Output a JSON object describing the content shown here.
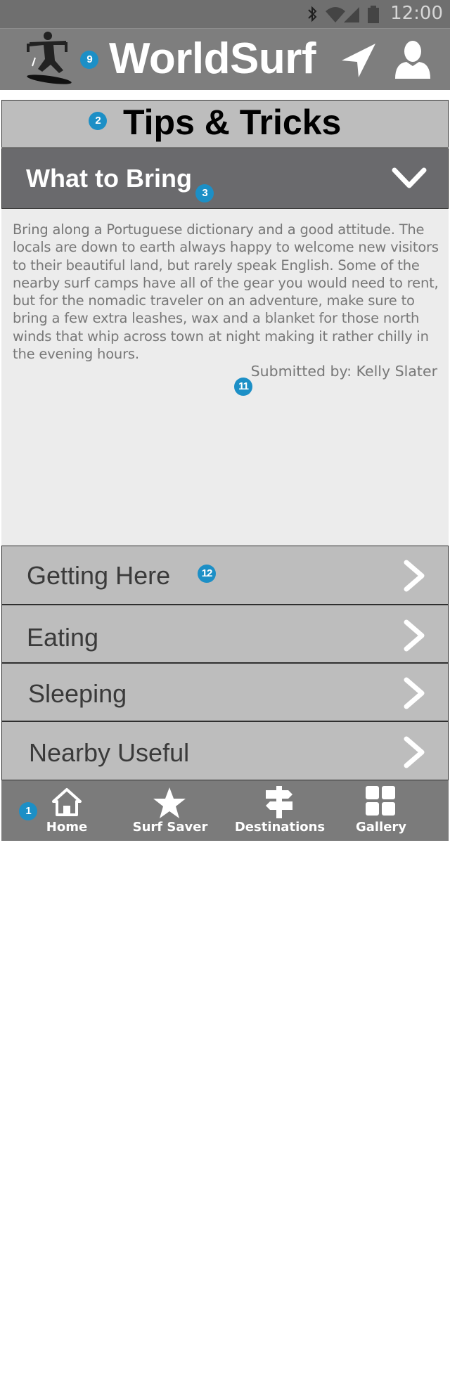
{
  "status_bar": {
    "time": "12:00",
    "icons": [
      "bluetooth-icon",
      "wifi-icon",
      "cell-signal-icon",
      "battery-icon"
    ]
  },
  "header": {
    "title": "WorldSurf",
    "icons": [
      "surfer-logo-icon",
      "navigation-arrow-icon",
      "user-profile-icon"
    ]
  },
  "section": {
    "title": "Tips & Tricks"
  },
  "expanded": {
    "title": "What to Bring",
    "body": "Bring along a Portuguese  dictionary and a good attitude. The locals are down to earth always happy to welcome new visitors to their beautiful land, but rarely speak English. Some of the nearby surf camps have all of the gear you would need to rent, but for the nomadic traveler on an adventure, make sure to  bring a few extra leashes, wax and a blanket for those north winds that whip across town at night making it rather chilly in the evening hours.",
    "submitted": "Submitted by: Kelly Slater"
  },
  "rows": [
    {
      "label": "Getting Here"
    },
    {
      "label": "Eating"
    },
    {
      "label": "Sleeping"
    },
    {
      "label": "Nearby Useful"
    }
  ],
  "nav": [
    {
      "label": "Home",
      "icon": "home-icon"
    },
    {
      "label": "Surf Saver",
      "icon": "star-icon"
    },
    {
      "label": "Destinations",
      "icon": "signpost-icon"
    },
    {
      "label": "Gallery",
      "icon": "grid-icon"
    }
  ],
  "markers": [
    "9",
    "2",
    "3",
    "11",
    "12",
    "1"
  ],
  "colors": {
    "marker": "#1c8fc6",
    "appbar": "#7e7e7e",
    "section_dark": "#6a6a6d",
    "section_light": "#bdbdbd"
  }
}
